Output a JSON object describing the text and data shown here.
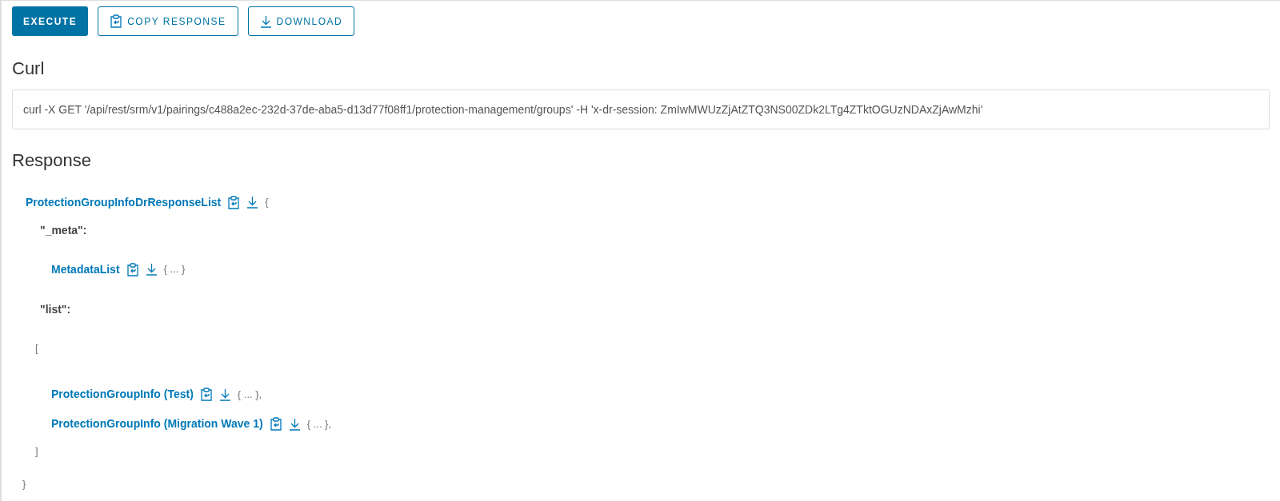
{
  "actions": [
    {
      "kind": "primary",
      "label": "EXECUTE"
    },
    {
      "kind": "copy",
      "label": "COPY RESPONSE"
    },
    {
      "kind": "download",
      "label": "DOWNLOAD"
    }
  ],
  "curl": {
    "heading": "Curl",
    "command": "curl -X GET '/api/rest/srm/v1/pairings/c488a2ec-232d-37de-aba5-d13d77f08ff1/protection-management/groups' -H 'x-dr-session: ZmIwMWUzZjAtZTQ3NS00ZDk2LTg4ZTktOGUzNDAxZjAwMzhi'"
  },
  "response": {
    "heading": "Response",
    "tree": {
      "kind": "model",
      "label": "ProtectionGroupInfoDrResponseList",
      "open": "{",
      "close": "}",
      "children": [
        {
          "kind": "key",
          "text": "\"_meta\":",
          "children": [
            {
              "kind": "model",
              "label": "MetadataList",
              "tail": "{ ... }"
            }
          ]
        },
        {
          "kind": "key",
          "text": "\"list\":",
          "children": [
            {
              "kind": "array",
              "open": "[",
              "close": "]",
              "children": [
                {
                  "kind": "model",
                  "label": "ProtectionGroupInfo (Test)",
                  "tail": "{ ... },"
                },
                {
                  "kind": "model",
                  "label": "ProtectionGroupInfo (Migration Wave 1)",
                  "tail": "{ ... },"
                }
              ]
            }
          ]
        }
      ]
    }
  }
}
